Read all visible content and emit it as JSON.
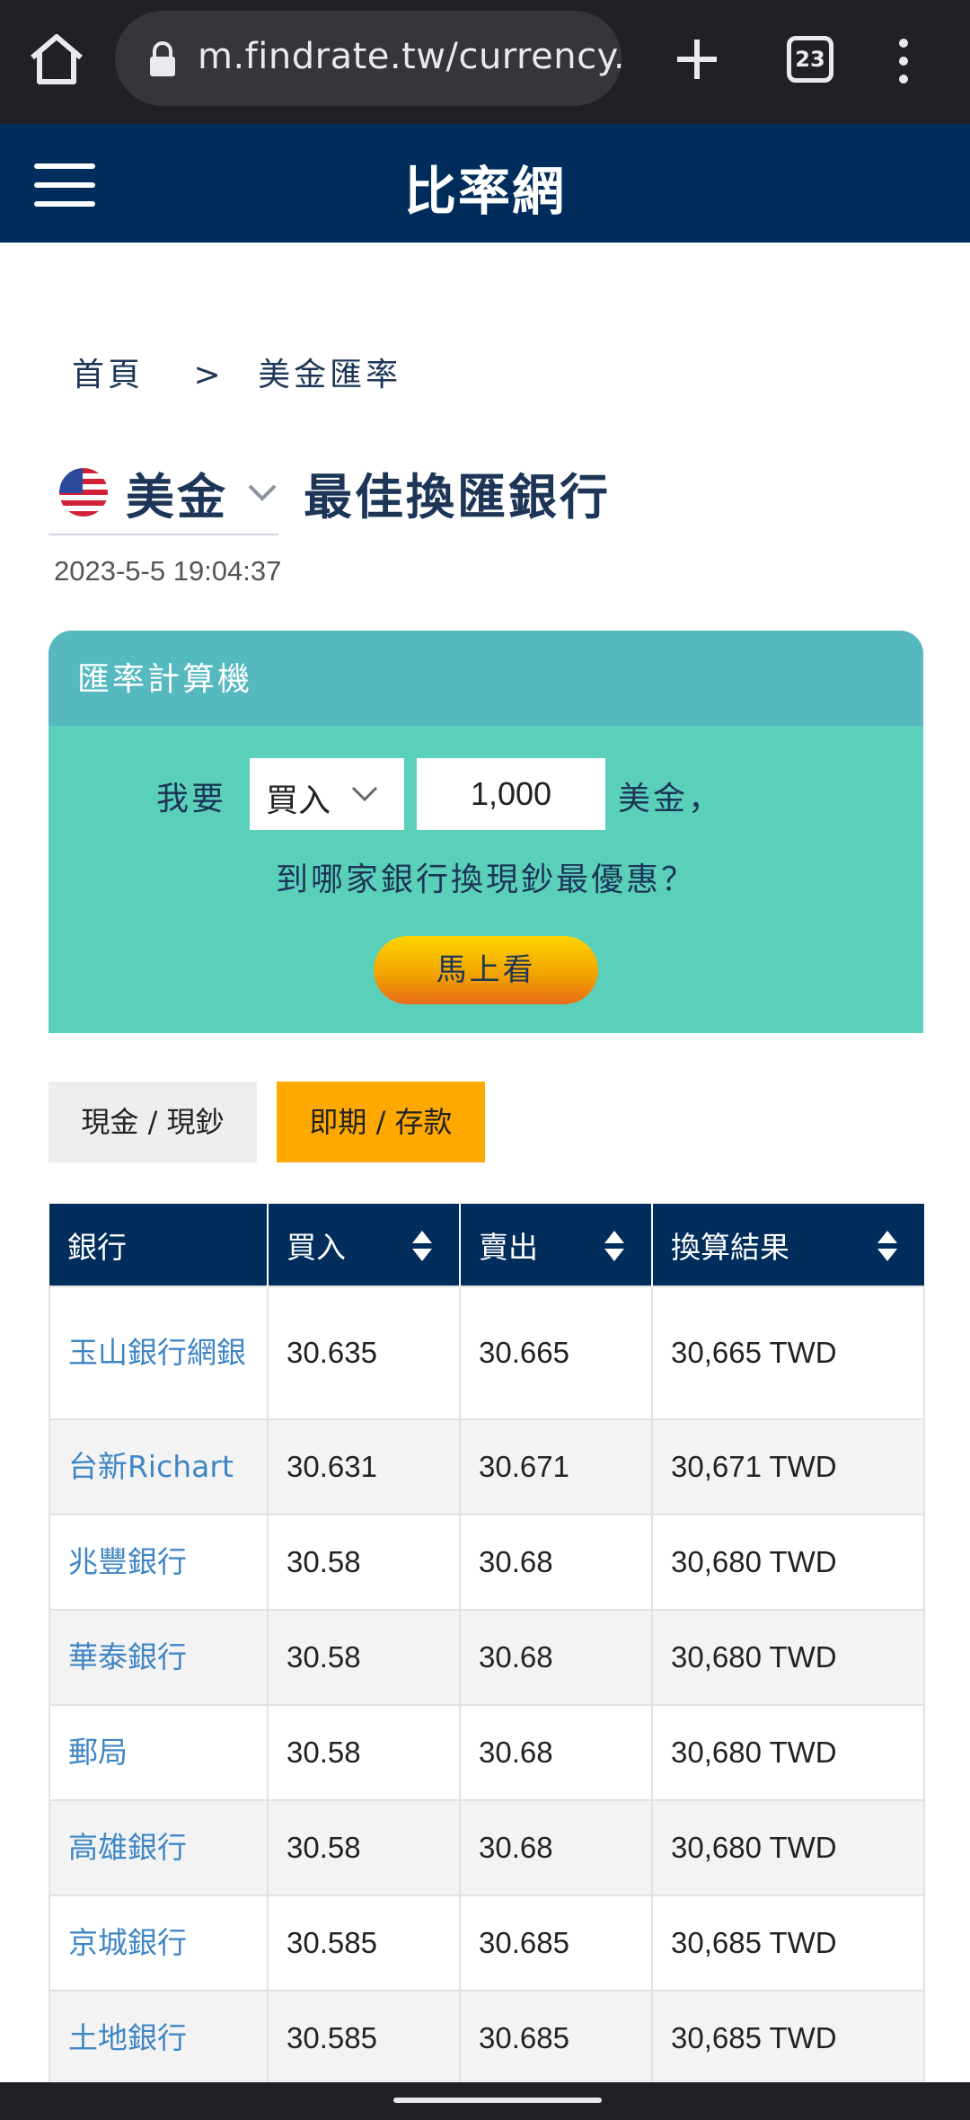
{
  "browser": {
    "url": "m.findrate.tw/currency.p",
    "tab_count": "23"
  },
  "site": {
    "title": "比率網"
  },
  "breadcrumb": {
    "home": "首頁",
    "separator": ">",
    "current": "美金匯率"
  },
  "heading": {
    "currency": "美金",
    "title": "最佳換匯銀行",
    "timestamp": "2023-5-5 19:04:37"
  },
  "calculator": {
    "header": "匯率計算機",
    "want_label": "我要",
    "action_value": "買入",
    "amount_value": "1,000",
    "currency_label": "美金，",
    "question": "到哪家銀行換現鈔最優惠？",
    "go_label": "馬上看"
  },
  "toggles": {
    "cash": "現金 / 現鈔",
    "spot": "即期 / 存款"
  },
  "table": {
    "headers": [
      "銀行",
      "買入",
      "賣出",
      "換算結果"
    ],
    "rows": [
      [
        "玉山銀行網銀",
        "30.635",
        "30.665",
        "30,665 TWD"
      ],
      [
        "台新Richart",
        "30.631",
        "30.671",
        "30,671 TWD"
      ],
      [
        "兆豐銀行",
        "30.58",
        "30.68",
        "30,680 TWD"
      ],
      [
        "華泰銀行",
        "30.58",
        "30.68",
        "30,680 TWD"
      ],
      [
        "郵局",
        "30.58",
        "30.68",
        "30,680 TWD"
      ],
      [
        "高雄銀行",
        "30.58",
        "30.68",
        "30,680 TWD"
      ],
      [
        "京城銀行",
        "30.585",
        "30.685",
        "30,685 TWD"
      ],
      [
        "土地銀行",
        "30.585",
        "30.685",
        "30,685 TWD"
      ]
    ]
  },
  "colors": {
    "header_navy": "#002d5c",
    "calc_teal": "#5ad0bb",
    "calc_header": "#55b9bf",
    "active_toggle": "#ffa900",
    "bank_link": "#3f86c6"
  }
}
